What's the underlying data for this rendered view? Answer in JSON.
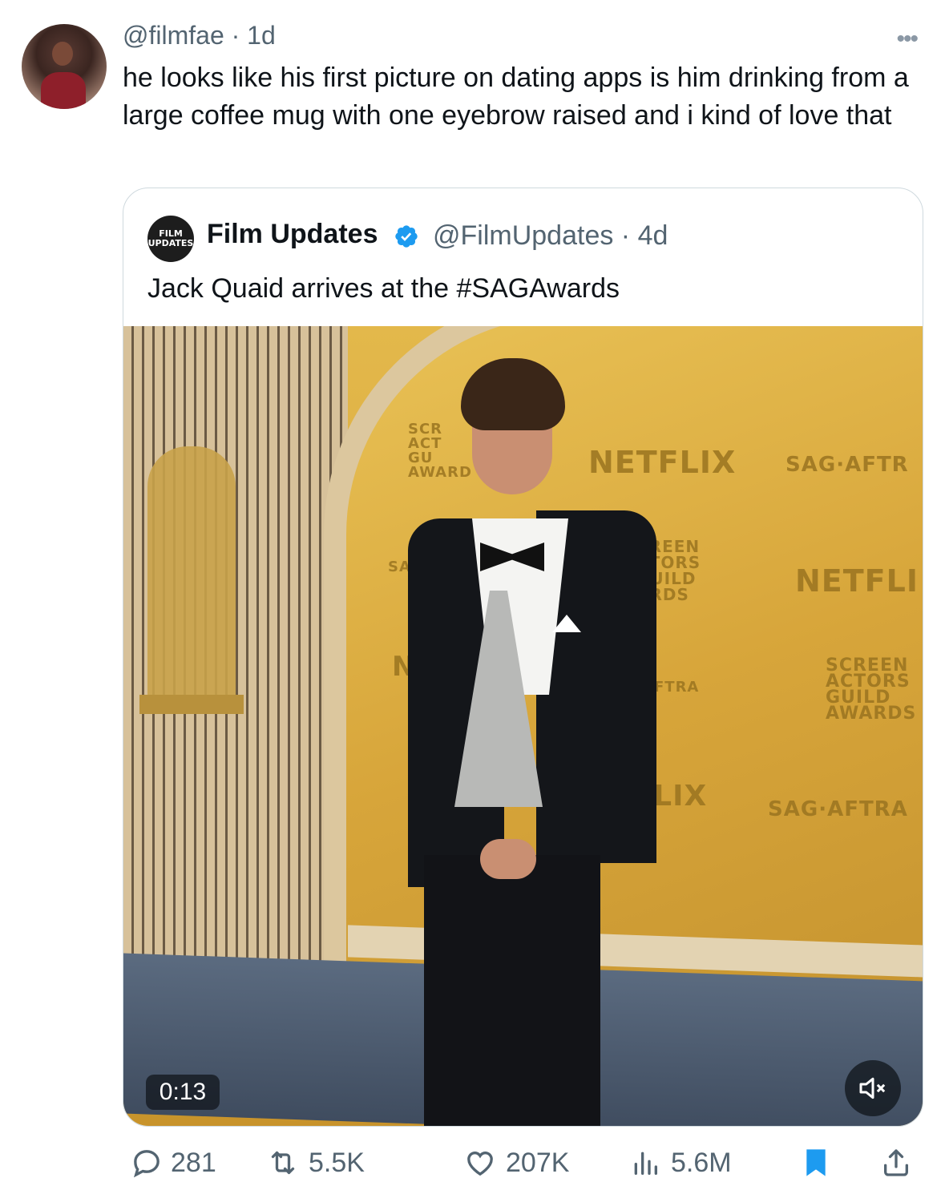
{
  "tweet": {
    "handle_time": "@filmfae · 1d",
    "text": "he looks like his first picture on dating apps is him drinking from a large coffee mug with one eyebrow raised and i kind of love that",
    "more_icon": "more-icon"
  },
  "quote": {
    "avatar_line1": "FILM",
    "avatar_line2": "UPDATES",
    "name": "Film Updates",
    "verified_icon": "verified-badge",
    "handle_time": "@FilmUpdates · 4d",
    "text": "Jack Quaid arrives at the #SAGAwards",
    "video": {
      "duration": "0:13",
      "backdrop": {
        "netflix_1": "NETFLIX",
        "netflix_2": "NETFLI",
        "netflix_3": "TFLIX",
        "sag_aftra_1": "SAG·AFTR",
        "sag_aftra_2": "SAG·AFTRA",
        "sag_small": "SAG·",
        "ne": "NE",
        "aftra_small": "FTRA",
        "sag_awards_logo_lines": [
          "SCREEN",
          "ACTORS",
          "GUILD",
          "AWARDS"
        ],
        "sag_awards_logo_partial": [
          "SCR",
          "ACT",
          "GU",
          "AWARD"
        ],
        "sag_awards_logo_mid": [
          "CREEN",
          "CTORS",
          "GUILD",
          "ARDS"
        ]
      }
    }
  },
  "actions": {
    "replies": "281",
    "reposts": "5.5K",
    "likes": "207K",
    "views": "5.6M"
  },
  "colors": {
    "text": "#0f1419",
    "secondary": "#536471",
    "accent": "#1d9bf0",
    "border": "#cfd9de"
  }
}
